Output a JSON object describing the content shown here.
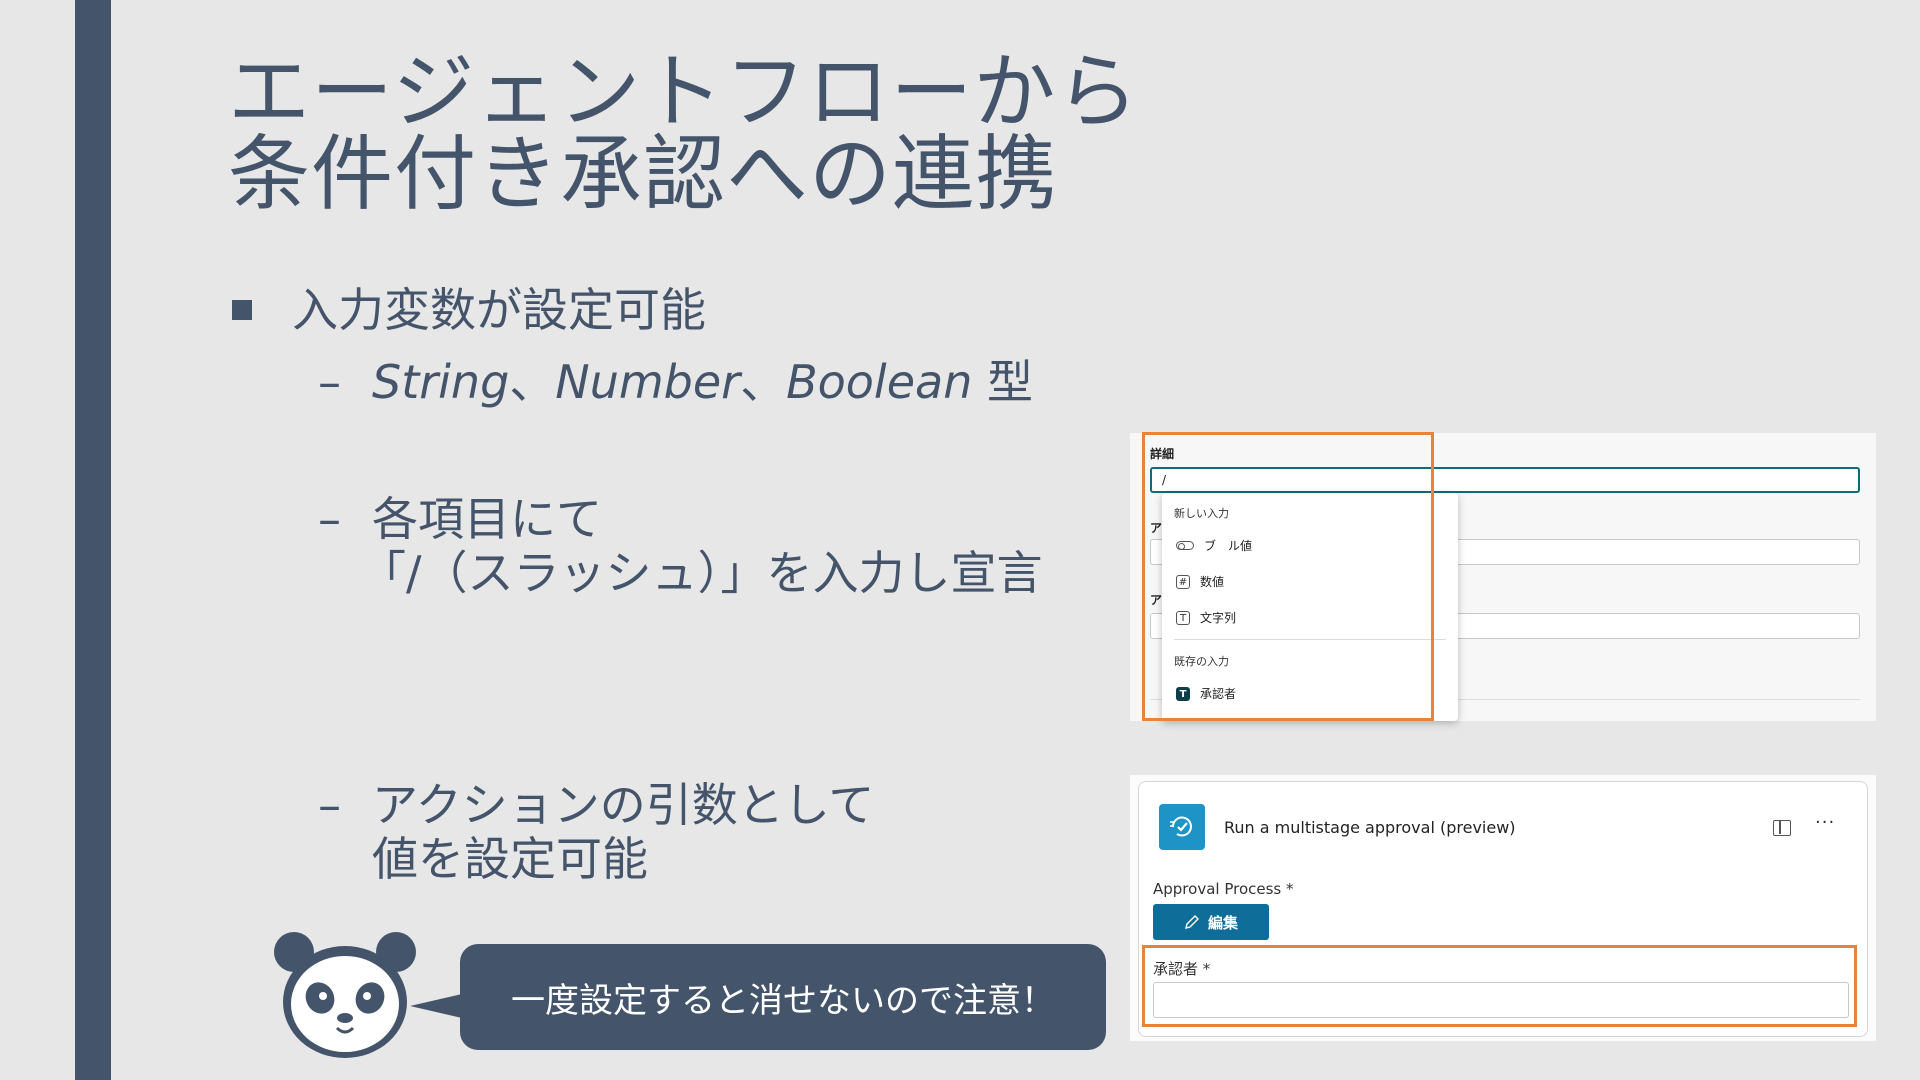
{
  "slide": {
    "title_line1": "エージェントフローから",
    "title_line2": "条件付き承認への連携",
    "bullet": "入力変数が設定可能",
    "sub1_string": "String",
    "sub1_sep1": "、",
    "sub1_number": "Number",
    "sub1_sep2": "、",
    "sub1_boolean": "Boolean",
    "sub1_suffix": " 型",
    "sub2_line1": "各項目にて",
    "sub2_line2": "「/（スラッシュ）」を入力し宣言",
    "sub3_line1": "アクションの引数として",
    "sub3_line2": "値を設定可能",
    "dash": "–",
    "speech": "一度設定すると消せないので注意！"
  },
  "shot1": {
    "detail_label": "詳細",
    "input_value": "/",
    "label_a1": "ア",
    "label_a2": "ア",
    "dropdown": {
      "new_input": "新しい入力",
      "boolean": "ブ　ル値",
      "number": "数値",
      "text": "文字列",
      "existing": "既存の入力",
      "approver": "承認者",
      "number_icon": "#",
      "text_icon": "T",
      "approver_icon": "T"
    }
  },
  "shot2": {
    "title": "Run a multistage approval (preview)",
    "more": "···",
    "approval_process_label": "Approval Process *",
    "edit_button": "編集",
    "approver_label": "承認者 *"
  },
  "colors": {
    "accent": "#44546a",
    "highlight": "#e8833a",
    "button": "#0f6d9a",
    "app_icon": "#1d93c6"
  }
}
